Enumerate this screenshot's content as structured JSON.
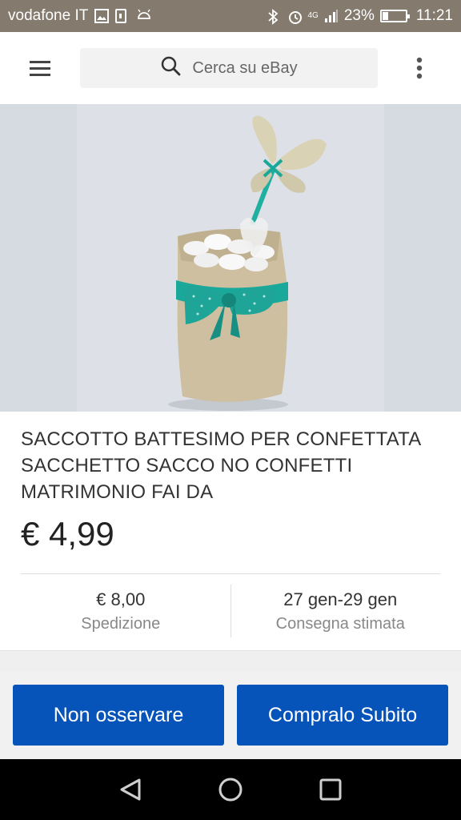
{
  "status_bar": {
    "carrier": "vodafone IT",
    "network": "4G",
    "battery_percent": "23%",
    "battery_level": 0.23,
    "time": "11:21",
    "icons": [
      "image-icon",
      "sim-icon",
      "android-icon",
      "bluetooth-icon",
      "alarm-icon",
      "signal-icon",
      "battery-charging-icon"
    ]
  },
  "app_bar": {
    "menu_icon": "hamburger-menu-icon",
    "search_placeholder": "Cerca su eBay",
    "search_icon": "search-icon",
    "more_icon": "more-vertical-icon"
  },
  "product": {
    "image_alt": "saccotto-battesimo-photo",
    "title": "SACCOTTO BATTESIMO PER CONFETTATA SACCHETTO SACCO NO CONFETTI MATRIMONIO FAI DA",
    "price": "€ 4,99"
  },
  "info": {
    "shipping_value": "€ 8,00",
    "shipping_label": "Spedizione",
    "delivery_value": "27 gen-29 gen",
    "delivery_label": "Consegna stimata"
  },
  "actions": {
    "unwatch_label": "Non osservare",
    "buy_now_label": "Compralo Subito"
  },
  "nav": {
    "back_icon": "back-triangle-icon",
    "home_icon": "home-circle-icon",
    "recents_icon": "recents-square-icon"
  },
  "colors": {
    "status_bar": "#847a6e",
    "button_blue": "#0654ba",
    "ribbon_teal": "#1aa89a"
  }
}
